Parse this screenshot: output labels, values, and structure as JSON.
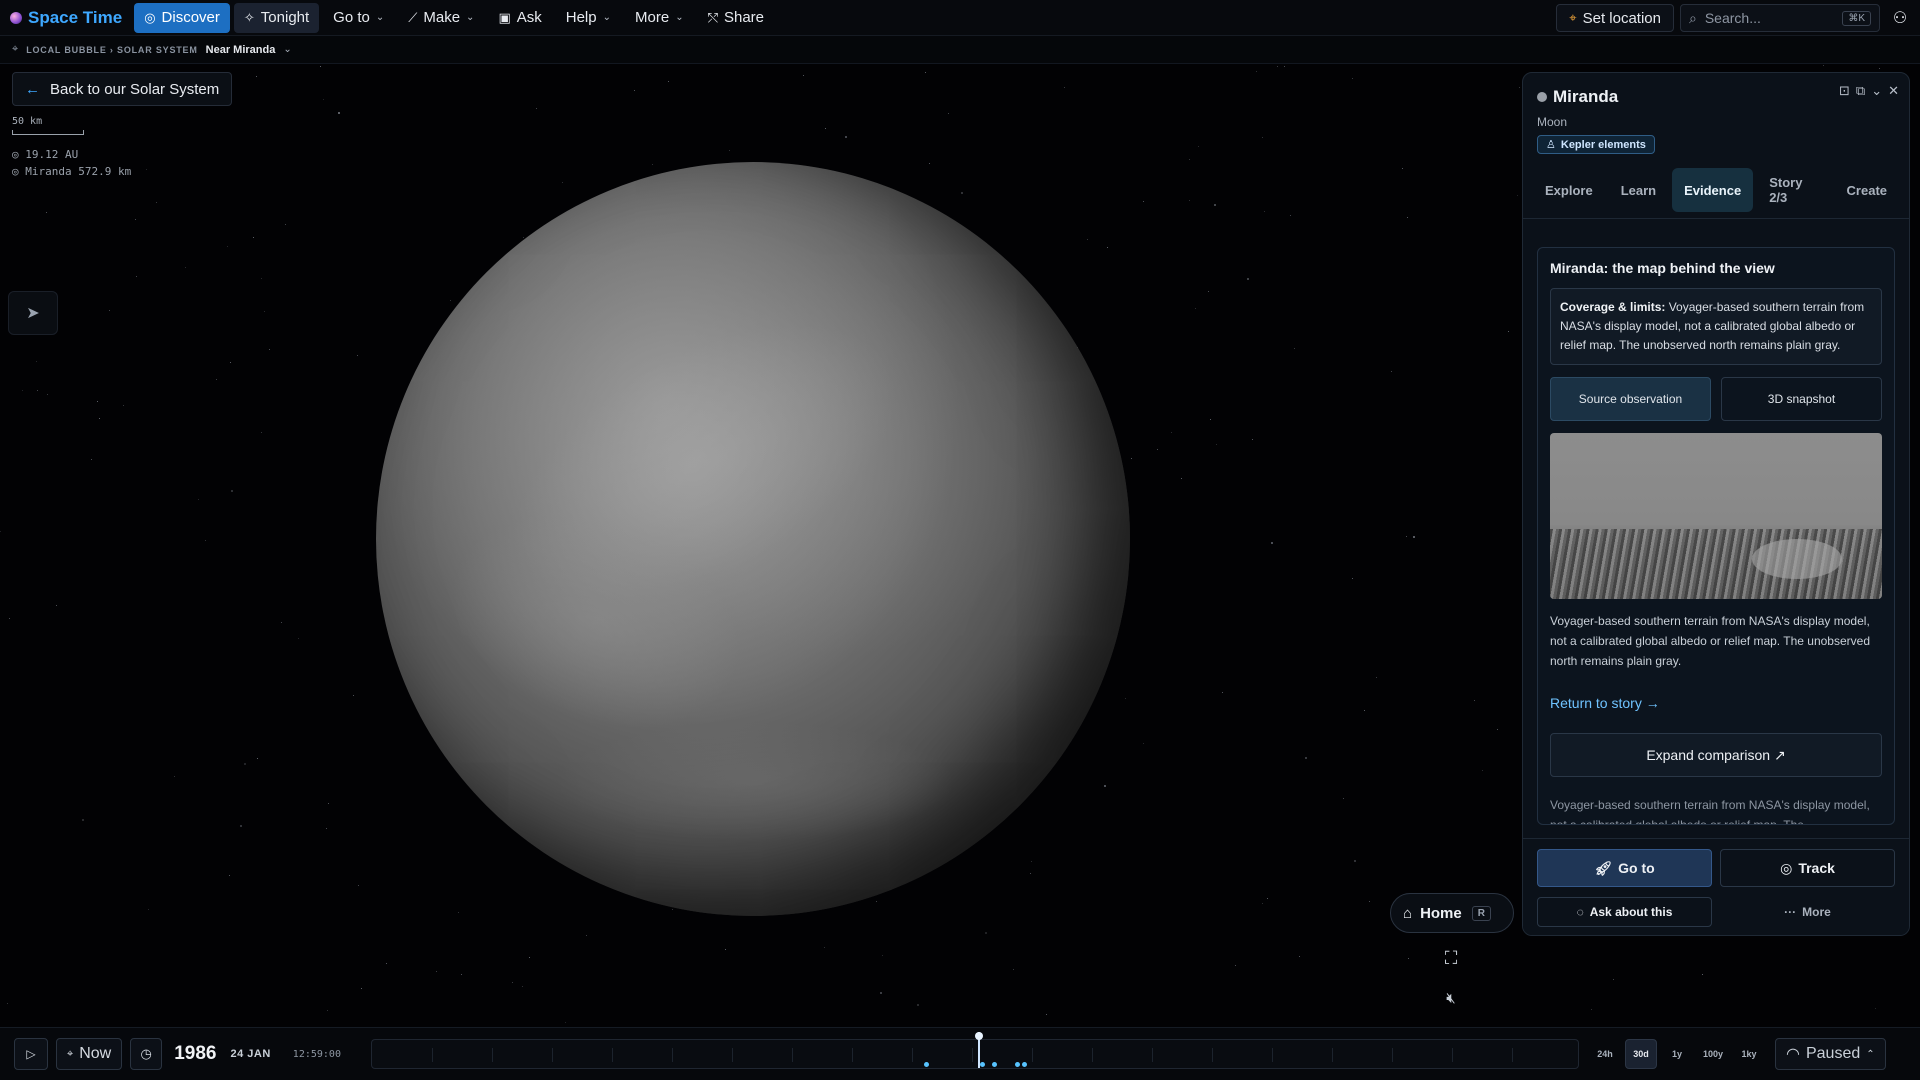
{
  "app": {
    "brand": "Space Time"
  },
  "nav": {
    "discover": "Discover",
    "tonight": "Tonight",
    "goto": "Go to",
    "make": "Make",
    "ask": "Ask",
    "help": "Help",
    "more": "More",
    "share": "Share"
  },
  "topright": {
    "set_location": "Set location",
    "search_placeholder": "Search...",
    "search_kbd": "⌘K"
  },
  "breadcrumb": {
    "path": "LOCAL BUBBLE › SOLAR SYSTEM",
    "current": "Near Miranda"
  },
  "overlay": {
    "back_button": "Back to our Solar System",
    "scale_label": "50 km",
    "distance_sun": "◎ 19.12 AU",
    "distance_body": "◎ Miranda 572.9 km"
  },
  "panel": {
    "title": "Miranda",
    "subtitle": "Moon",
    "badge": "Kepler elements",
    "tabs": [
      "Explore",
      "Learn",
      "Evidence",
      "Story 2/3",
      "Create"
    ],
    "active_tab": "Evidence",
    "card": {
      "title": "Miranda: the map behind the view",
      "note_label": "Coverage & limits:",
      "note_text": " Voyager-based southern terrain from NASA's display model, not a calibrated global albedo or relief map. The unobserved north remains plain gray.",
      "seg_source": "Source observation",
      "seg_snapshot": "3D snapshot",
      "caption": "Voyager-based southern terrain from NASA's display model, not a calibrated global albedo or relief map. The unobserved north remains plain gray.",
      "story_link": "Return to story →",
      "expand": "Expand comparison ↗",
      "caption_repeat": "Voyager-based southern terrain from NASA's display model, not a calibrated global albedo or relief map. The"
    },
    "actions": {
      "goto": "Go to",
      "track": "Track",
      "ask": "Ask about this",
      "more": "More"
    }
  },
  "controls": {
    "home": "Home",
    "home_kbd": "R"
  },
  "timeline": {
    "now": "Now",
    "year": "1986",
    "date": "24 JAN",
    "time": "12:59:00",
    "zoom": [
      "24h",
      "30d",
      "1y",
      "100y",
      "1ky"
    ],
    "zoom_active": "30d",
    "status": "Paused"
  },
  "colors": {
    "accent": "#3ea8ff",
    "active_nav": "#1d6fc2",
    "event_dot": "#58c4ff"
  }
}
